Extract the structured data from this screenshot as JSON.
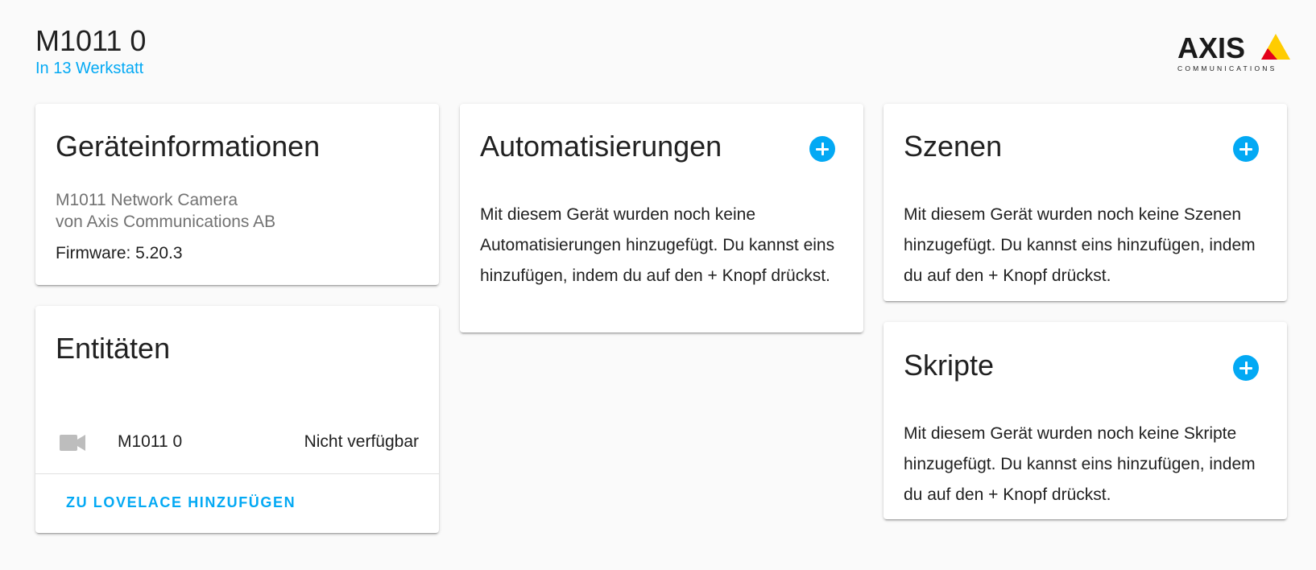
{
  "header": {
    "title": "M1011 0",
    "area": "In 13 Werkstatt"
  },
  "logo": {
    "brand": "AXIS",
    "tagline": "COMMUNICATIONS"
  },
  "device_info": {
    "title": "Geräteinformationen",
    "model": "M1011 Network Camera",
    "manufacturer": "von Axis Communications AB",
    "firmware": "Firmware: 5.20.3"
  },
  "entities": {
    "title": "Entitäten",
    "items": [
      {
        "icon": "video-camera-icon",
        "name": "M1011 0",
        "state": "Nicht verfügbar"
      }
    ],
    "add_button": "ZU LOVELACE HINZUFÜGEN"
  },
  "automations": {
    "title": "Automatisierungen",
    "empty_text": "Mit diesem Gerät wurden noch keine Automatisierungen hinzugefügt. Du kannst eins hinzufügen, indem du auf den + Knopf drückst."
  },
  "scenes": {
    "title": "Szenen",
    "empty_text": "Mit diesem Gerät wurden noch keine Szenen hinzugefügt. Du kannst eins hinzufügen, indem du auf den + Knopf drückst."
  },
  "scripts": {
    "title": "Skripte",
    "empty_text": "Mit diesem Gerät wurden noch keine Skripte hinzugefügt. Du kannst eins hinzufügen, indem du auf den + Knopf drückst."
  },
  "colors": {
    "accent": "#03a9f4",
    "background": "#fafafa",
    "logo_red": "#e3001b",
    "logo_yellow": "#ffcc00"
  }
}
